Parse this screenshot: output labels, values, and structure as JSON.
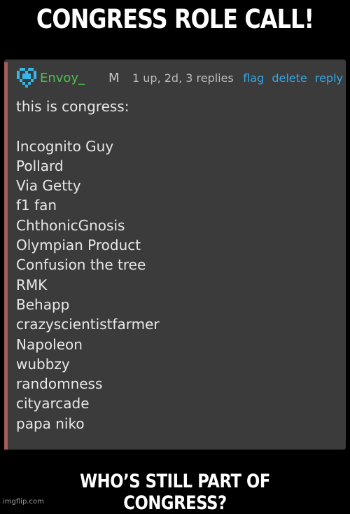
{
  "meme": {
    "top_text": "CONGRESS ROLE CALL!",
    "bottom_text": "WHO’S STILL PART OF CONGRESS?",
    "watermark": "imgflip.com"
  },
  "comment": {
    "username": "Envoy_",
    "badge": "M",
    "meta": "1 up, 2d, 3 replies",
    "actions": {
      "flag": "flag",
      "delete": "delete",
      "reply": "reply"
    },
    "intro": "this is congress:",
    "members": [
      "Incognito Guy",
      "Pollard",
      "Via Getty",
      "f1 fan",
      "ChthonicGnosis",
      "Olympian Product",
      "Confusion the tree",
      "RMK",
      "Behapp",
      "crazyscientistfarmer",
      "Napoleon",
      "wubbzy",
      "randomness",
      "cityarcade",
      "papa niko"
    ]
  },
  "colors": {
    "username": "#4fc04f",
    "links": "#34a8e8",
    "avatar": "#35b8e8",
    "panel": "#3b3b3c",
    "thread_bar": "#a45c5c"
  },
  "icons": {
    "avatar": "pixel-heart-icon"
  }
}
